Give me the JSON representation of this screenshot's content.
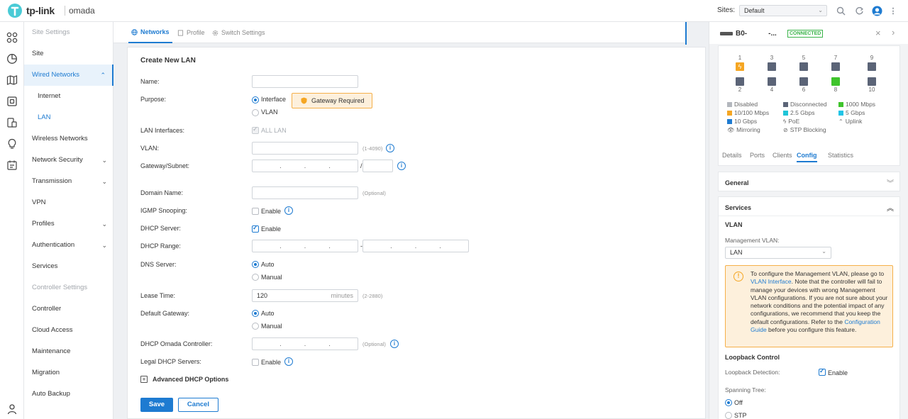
{
  "header": {
    "brand": "tp-link",
    "product": "omada",
    "sites_label": "Sites:",
    "site_selected": "Default"
  },
  "sidebar": {
    "section_site_settings": "Site Settings",
    "items": [
      {
        "label": "Site"
      },
      {
        "label": "Wired Networks"
      },
      {
        "label": "Internet"
      },
      {
        "label": "LAN"
      },
      {
        "label": "Wireless Networks"
      },
      {
        "label": "Network Security"
      },
      {
        "label": "Transmission"
      },
      {
        "label": "VPN"
      },
      {
        "label": "Profiles"
      },
      {
        "label": "Authentication"
      },
      {
        "label": "Services"
      }
    ],
    "section_controller_settings": "Controller Settings",
    "controller_items": [
      {
        "label": "Controller"
      },
      {
        "label": "Cloud Access"
      },
      {
        "label": "Maintenance"
      },
      {
        "label": "Migration"
      },
      {
        "label": "Auto Backup"
      }
    ]
  },
  "tabs": [
    {
      "label": "Networks"
    },
    {
      "label": "Profile"
    },
    {
      "label": "Switch Settings"
    }
  ],
  "form": {
    "title": "Create New LAN",
    "name_label": "Name:",
    "purpose_label": "Purpose:",
    "purpose_interface": "Interface",
    "purpose_vlan": "VLAN",
    "gateway_required": "Gateway Required",
    "lan_interfaces_label": "LAN Interfaces:",
    "all_lan": "ALL LAN",
    "vlan_label": "VLAN:",
    "vlan_hint": "(1-4090)",
    "gateway_subnet_label": "Gateway/Subnet:",
    "slash": "/",
    "domain_name_label": "Domain Name:",
    "optional_hint": "(Optional)",
    "igmp_label": "IGMP Snooping:",
    "enable": "Enable",
    "dhcp_server_label": "DHCP Server:",
    "dhcp_range_label": "DHCP Range:",
    "range_dash": "-",
    "dns_server_label": "DNS Server:",
    "auto": "Auto",
    "manual": "Manual",
    "lease_time_label": "Lease Time:",
    "lease_time_value": "120",
    "lease_unit": "minutes",
    "lease_hint": "(2-2880)",
    "default_gateway_label": "Default Gateway:",
    "dhcp_omada_label": "DHCP Omada Controller:",
    "legal_dhcp_label": "Legal DHCP Servers:",
    "advanced_label": "Advanced DHCP Options",
    "save": "Save",
    "cancel": "Cancel"
  },
  "right_panel": {
    "device_name": "B0-",
    "device_suffix": "-...",
    "status": "CONNECTED",
    "port_numbers_top": [
      "1",
      "3",
      "5",
      "7",
      "9"
    ],
    "port_numbers_bottom": [
      "2",
      "4",
      "6",
      "8",
      "10"
    ],
    "legend": [
      {
        "label": "Disabled",
        "color": "#b3b7bd"
      },
      {
        "label": "Disconnected",
        "color": "#5b6477"
      },
      {
        "label": "1000 Mbps",
        "color": "#3fc42c"
      },
      {
        "label": "10/100 Mbps",
        "color": "#f5a623"
      },
      {
        "label": "2.5 Gbps",
        "color": "#1fc5d8"
      },
      {
        "label": "5 Gbps",
        "color": "#20c4e6"
      },
      {
        "label": "10 Gbps",
        "color": "#1e7bd1"
      },
      {
        "label": "PoE",
        "icon": "bolt-icon"
      },
      {
        "label": "Uplink",
        "icon": "uplink-icon"
      },
      {
        "label": "Mirroring",
        "icon": "eye-icon"
      },
      {
        "label": "STP Blocking",
        "icon": "block-icon"
      }
    ],
    "tabs": [
      "Details",
      "Ports",
      "Clients",
      "Config",
      "Statistics"
    ],
    "general_title": "General",
    "services_title": "Services",
    "vlan_title": "VLAN",
    "mgmt_vlan_label": "Management VLAN:",
    "mgmt_vlan_value": "LAN",
    "warning": {
      "t1": "To configure the Management VLAN, please go to ",
      "link1": "VLAN Interface",
      "t2": ". Note that the controller will fail to manage your devices with wrong Management VLAN configurations. If you are not sure about your network conditions and the potential impact of any configurations, we recommend that you keep the default configurations. Refer to the ",
      "link2": "Configuration Guide",
      "t3": " before you configure this feature."
    },
    "loopback_title": "Loopback Control",
    "loopback_label": "Loopback Detection:",
    "loopback_enable": "Enable",
    "spanning_label": "Spanning Tree:",
    "spanning_off": "Off",
    "spanning_stp": "STP"
  }
}
